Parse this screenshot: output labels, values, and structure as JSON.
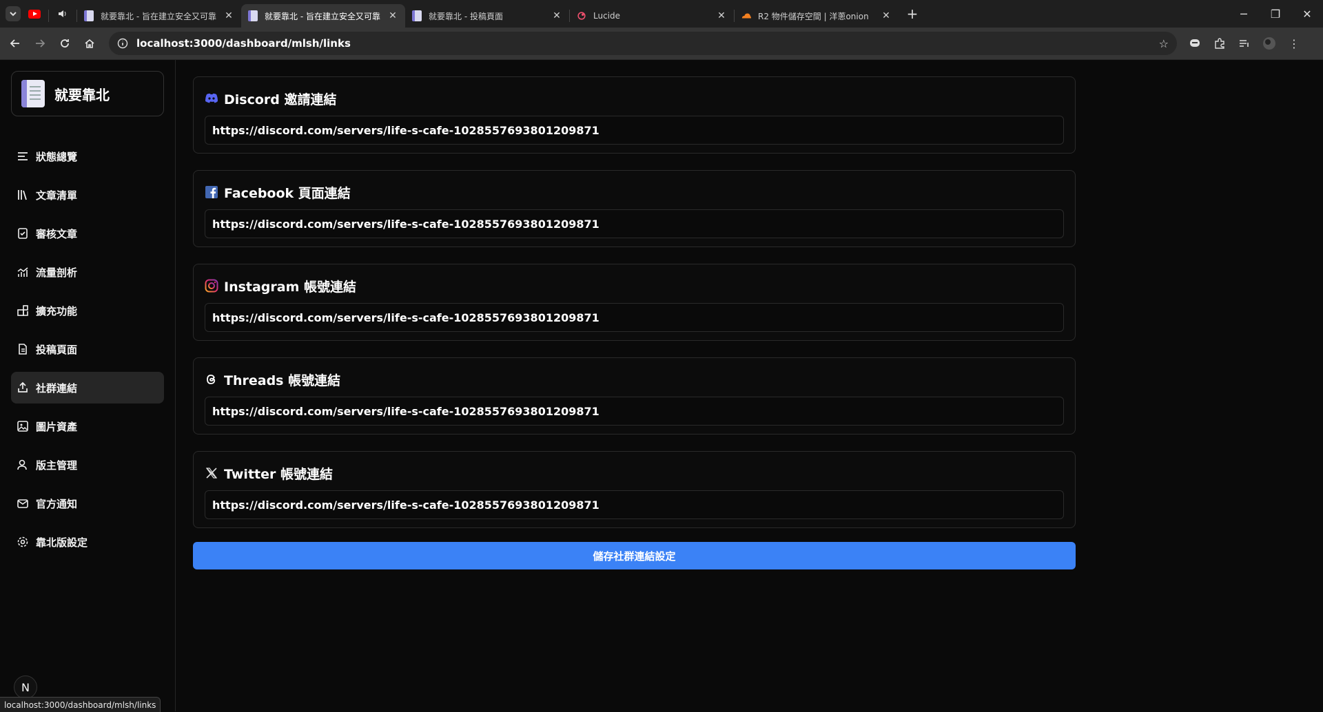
{
  "browser": {
    "tabs": [
      {
        "title": "就要靠北 - 旨在建立安全又可靠",
        "active": false
      },
      {
        "title": "就要靠北 - 旨在建立安全又可靠",
        "active": true
      },
      {
        "title": "就要靠北 - 投稿頁面",
        "active": false
      },
      {
        "title": "Lucide",
        "active": false
      },
      {
        "title": "R2 物件儲存空間 | 洋蔥onion",
        "active": false
      }
    ],
    "url": "localhost:3000/dashboard/mlsh/links",
    "status_url": "localhost:3000/dashboard/mlsh/links"
  },
  "sidebar": {
    "brand": "就要靠北",
    "items": [
      {
        "label": "狀態總覽",
        "icon": "list-icon"
      },
      {
        "label": "文章清單",
        "icon": "library-icon"
      },
      {
        "label": "審核文章",
        "icon": "square-check-icon"
      },
      {
        "label": "流量剖析",
        "icon": "chart-icon"
      },
      {
        "label": "擴充功能",
        "icon": "blocks-icon"
      },
      {
        "label": "投稿頁面",
        "icon": "file-text-icon"
      },
      {
        "label": "社群連結",
        "icon": "share-icon",
        "active": true
      },
      {
        "label": "圖片資產",
        "icon": "image-icon"
      },
      {
        "label": "版主管理",
        "icon": "user-icon"
      },
      {
        "label": "官方通知",
        "icon": "mail-icon"
      },
      {
        "label": "靠北版設定",
        "icon": "settings-icon"
      }
    ],
    "next_badge": "N"
  },
  "links": [
    {
      "title": "Discord 邀請連結",
      "icon": "discord-icon",
      "value": "https://discord.com/servers/life-s-cafe-1028557693801209871"
    },
    {
      "title": "Facebook 頁面連結",
      "icon": "facebook-icon",
      "value": "https://discord.com/servers/life-s-cafe-1028557693801209871"
    },
    {
      "title": "Instagram 帳號連結",
      "icon": "instagram-icon",
      "value": "https://discord.com/servers/life-s-cafe-1028557693801209871"
    },
    {
      "title": "Threads 帳號連結",
      "icon": "threads-icon",
      "value": "https://discord.com/servers/life-s-cafe-1028557693801209871"
    },
    {
      "title": "Twitter 帳號連結",
      "icon": "x-icon",
      "value": "https://discord.com/servers/life-s-cafe-1028557693801209871"
    }
  ],
  "save_label": "儲存社群連結設定",
  "colors": {
    "accent": "#3b82f6",
    "discord": "#5865f2",
    "facebook": "#1877f2",
    "instagram": "#e1306c"
  }
}
